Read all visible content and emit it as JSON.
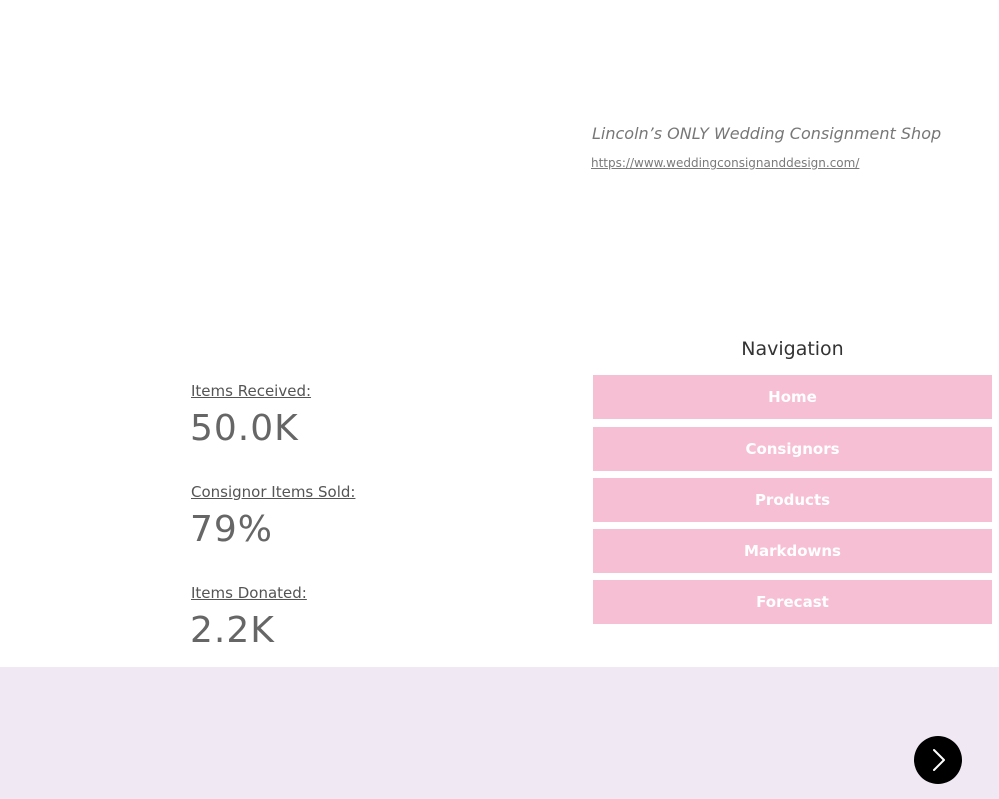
{
  "header": {
    "tagline": "Lincoln’s ONLY Wedding Consignment Shop",
    "website": "https://www.weddingconsignanddesign.com/"
  },
  "stats": [
    {
      "label": "Items Received:",
      "value": "50.0K"
    },
    {
      "label": "Consignor Items Sold:",
      "value": "79%"
    },
    {
      "label": "Items Donated:",
      "value": "2.2K"
    }
  ],
  "navigation": {
    "title": "Navigation",
    "items": [
      {
        "label": "Home"
      },
      {
        "label": "Consignors"
      },
      {
        "label": "Products"
      },
      {
        "label": "Markdowns"
      },
      {
        "label": "Forecast"
      }
    ]
  },
  "footer": {
    "next_icon": "chevron-right-icon"
  },
  "colors": {
    "nav_button_bg": "#f6bfd4",
    "footer_bg": "#f0e8f2",
    "next_button_bg": "#000000"
  }
}
